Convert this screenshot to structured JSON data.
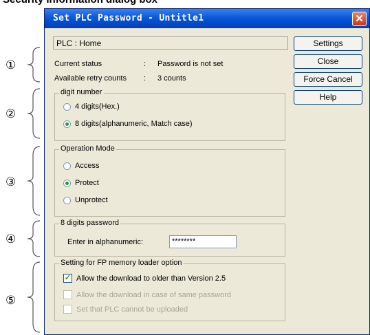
{
  "heading": "Security Information dialog box",
  "dialog": {
    "title": "Set PLC Password - Untitle1",
    "plc_label": "PLC : Home",
    "status": {
      "current_status_label": "Current status",
      "current_status_sep": ":",
      "current_status_value": "Password is not set",
      "retry_label": "Available retry counts",
      "retry_sep": ":",
      "retry_value": "3 counts"
    },
    "digit_group": {
      "title": "digit number",
      "options": [
        "4 digits(Hex.)",
        "8 digits(alphanumeric, Match case)"
      ],
      "selected": "8 digits(alphanumeric, Match case)"
    },
    "mode_group": {
      "title": "Operation Mode",
      "options": [
        "Access",
        "Protect",
        "Unprotect"
      ],
      "selected": "Protect"
    },
    "password_group": {
      "title": "8 digits password",
      "label": "Enter in alphanumeric:",
      "value": "********"
    },
    "loader_group": {
      "title": "Setting for FP memory loader option",
      "options": [
        {
          "label": "Allow the download to older than Version 2.5",
          "checked": true,
          "enabled": true
        },
        {
          "label": "Allow the download in case of same password",
          "checked": false,
          "enabled": false
        },
        {
          "label": "Set that PLC cannot be uploaded",
          "checked": false,
          "enabled": false
        }
      ]
    },
    "buttons": [
      "Settings",
      "Close",
      "Force Cancel",
      "Help"
    ],
    "close_glyph": "✕"
  },
  "markers": [
    "①",
    "②",
    "③",
    "④",
    "⑤"
  ],
  "colors": {
    "titlebar": "#0a58d8",
    "dialog_bg": "#ece9d8",
    "close_button": "#c4391a",
    "radio_dot": "#21a121"
  }
}
